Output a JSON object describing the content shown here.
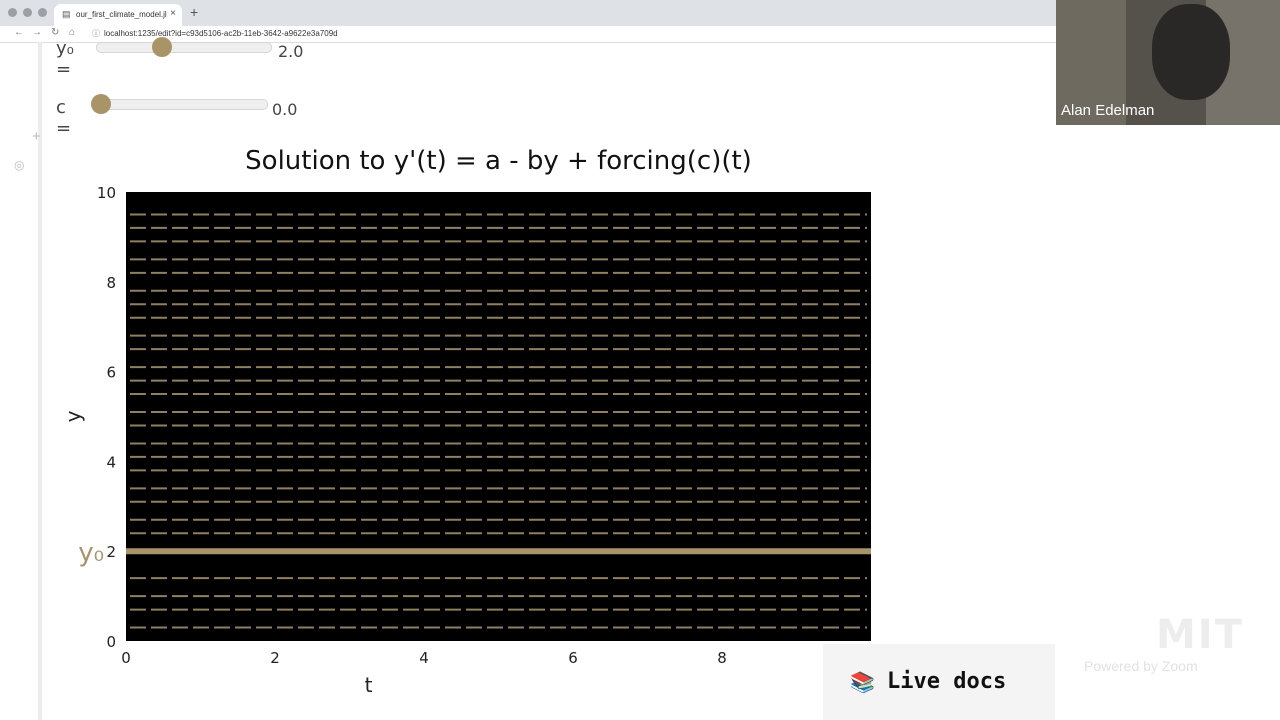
{
  "browser": {
    "tab_title": "our_first_climate_model.jl",
    "tab_close": "×",
    "new_tab": "+",
    "url": "localhost:1235/edit?id=c93d5106-ac2b-11eb-3642-a9622e3a709d"
  },
  "sliders": [
    {
      "label": "y₀ =",
      "value_text": "2.0",
      "fraction": 0.5
    },
    {
      "label": "c =",
      "value_text": "0.0",
      "fraction": 0.0
    }
  ],
  "chart_data": {
    "type": "line",
    "title": "Solution to y'(t) = a - by + forcing(c)(t)",
    "xlabel": "t",
    "ylabel": "y",
    "xlim": [
      0,
      10
    ],
    "ylim": [
      0,
      10
    ],
    "x_ticks": [
      "0",
      "2",
      "4",
      "6",
      "8"
    ],
    "y_ticks": [
      "0",
      "2",
      "4",
      "6",
      "8",
      "10"
    ],
    "annotation": "y₀",
    "background": "#000000",
    "grid": false,
    "series": [
      {
        "values_x": [
          0,
          10
        ],
        "values_y": [
          2,
          2
        ],
        "style": "solid",
        "color": "#a8946a"
      }
    ],
    "direction_field_rows": [
      0.3,
      0.7,
      1.0,
      1.4,
      2.4,
      2.7,
      3.1,
      3.4,
      3.8,
      4.1,
      4.4,
      4.8,
      5.1,
      5.5,
      5.8,
      6.1,
      6.5,
      6.8,
      7.2,
      7.5,
      7.8,
      8.2,
      8.5,
      8.9,
      9.2,
      9.5
    ]
  },
  "live_docs": {
    "icon": "books-icon",
    "label": "Live docs"
  },
  "video": {
    "name": "Alan Edelman",
    "logo": "MIT",
    "watermark": "Powered by Zoom"
  }
}
